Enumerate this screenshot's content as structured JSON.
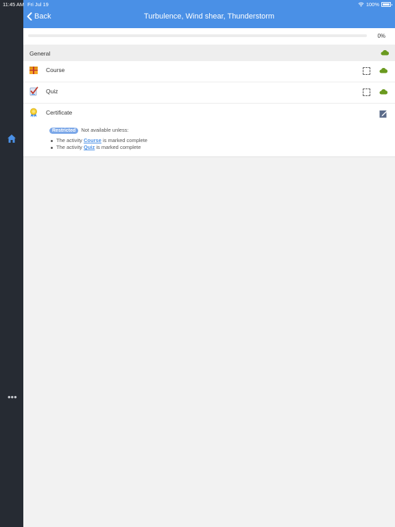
{
  "status_bar": {
    "time": "11:45 AM",
    "date": "Fri Jul 19",
    "battery": "100%"
  },
  "header": {
    "back_label": "Back",
    "title": "Turbulence, Wind shear, Thunderstorm"
  },
  "progress": {
    "value": 0,
    "label": "0%"
  },
  "section": {
    "title": "General"
  },
  "activities": [
    {
      "label": "Course",
      "icon": "package-icon"
    },
    {
      "label": "Quiz",
      "icon": "quiz-checklist-icon"
    }
  ],
  "certificate": {
    "label": "Certificate",
    "icon": "certificate-icon",
    "badge": "Restricted",
    "restriction_text": "Not available unless:",
    "conditions": [
      {
        "prefix": "The activity ",
        "link": "Course",
        "suffix": " is marked complete"
      },
      {
        "prefix": "The activity ",
        "link": "Quiz",
        "suffix": " is marked complete"
      }
    ]
  },
  "colors": {
    "accent": "#4a90e6",
    "sidebar": "#262b33",
    "cloud": "#6a9a1f"
  }
}
